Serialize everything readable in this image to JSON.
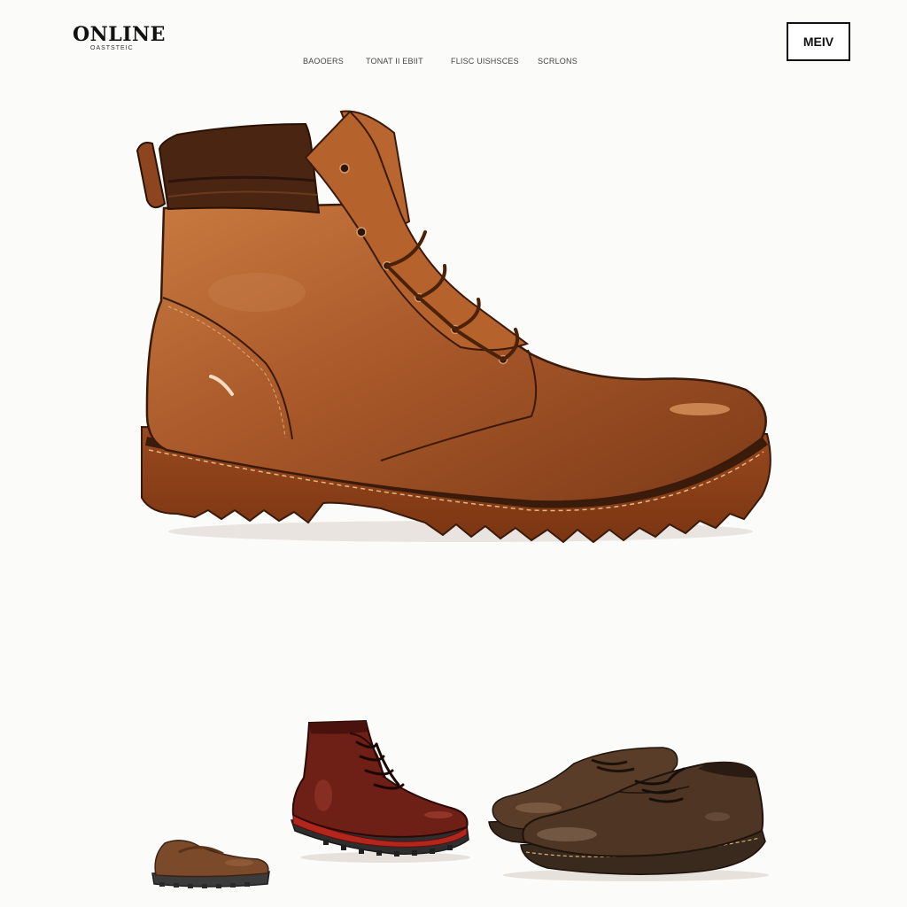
{
  "brand": {
    "name": "ONLINE",
    "tagline": "OASTSTEIC"
  },
  "nav": {
    "items": [
      {
        "label": "BAOOERS"
      },
      {
        "label": "TONAT II EBIIT"
      },
      {
        "label": "FLISC UISHSCES"
      },
      {
        "label": "SCRLONS"
      }
    ]
  },
  "header": {
    "menu_label": "MEIV"
  },
  "colors": {
    "accent": "#111111",
    "hero_leather": "#a9592a",
    "sole": "#8b4019",
    "oxblood": "#6e1f16",
    "dark_leather": "#4e3524"
  },
  "icons": {
    "hero": "brown-leather-ankle-boot-image",
    "product_1": "brown-suede-shoe-image",
    "product_2": "oxblood-boot-image",
    "product_3": "dark-brown-oxfords-image"
  }
}
